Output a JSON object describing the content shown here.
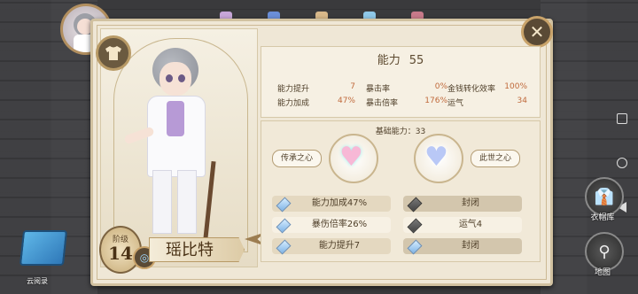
{
  "stats": {
    "title_label": "能力",
    "title_value": "55",
    "rows": [
      {
        "label": "能力提升",
        "value": "7"
      },
      {
        "label": "暴击率",
        "value": "0%"
      },
      {
        "label": "金钱转化效率",
        "value": "100%"
      },
      {
        "label": "能力加成",
        "value": "47%"
      },
      {
        "label": "暴击倍率",
        "value": "176%"
      },
      {
        "label": "运气",
        "value": "34"
      }
    ]
  },
  "base": {
    "title": "基础能力：33",
    "left_tag": "传承之心",
    "right_tag": "此世之心",
    "slots_left": [
      "能力加成47%",
      "暴伤倍率26%",
      "能力提升7"
    ],
    "slots_right": [
      "封闭",
      "运气4",
      "封闭"
    ]
  },
  "character": {
    "level_label": "阶级",
    "level_value": "14",
    "name": "瑶比特"
  },
  "side": {
    "wardrobe_label": "衣帽库",
    "map_label": "地图",
    "cloud_label": "云阅录"
  },
  "colors": {
    "value_accent": "#c06a3c",
    "panel": "#efe7d6",
    "gold_border": "#c9a36a"
  }
}
